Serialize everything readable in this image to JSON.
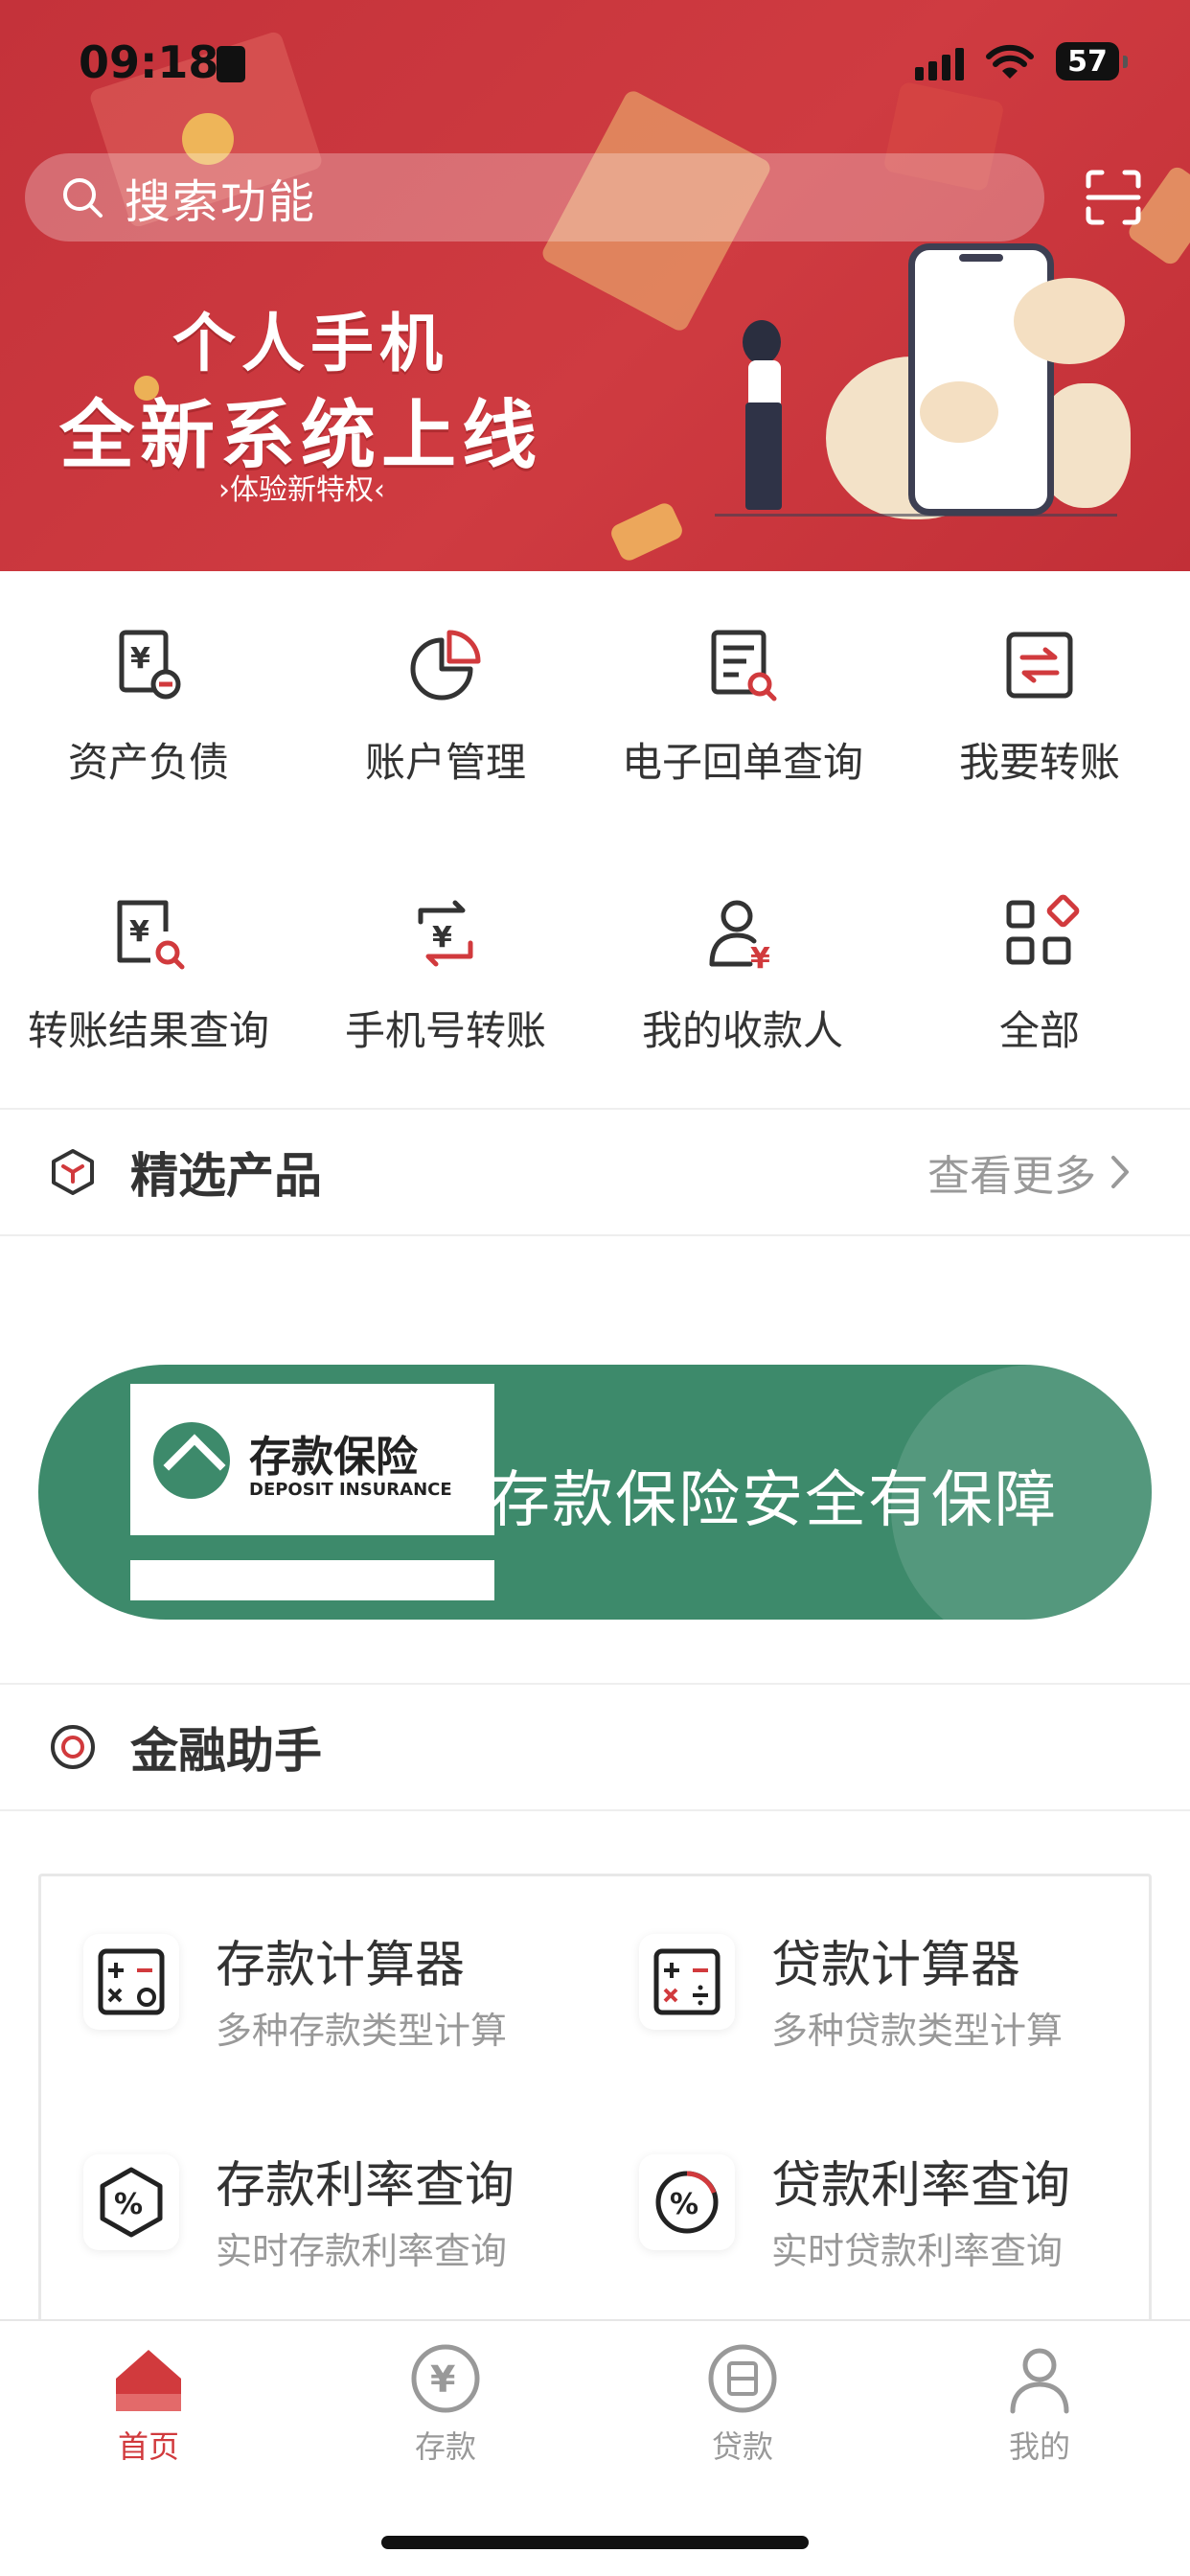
{
  "status_bar": {
    "time": "09:18",
    "battery": "57"
  },
  "search": {
    "placeholder": "搜索功能"
  },
  "banner": {
    "title_line1": "个人手机",
    "title_line2": "全新系统上线",
    "subtitle": "›体验新特权‹"
  },
  "quick_menu": [
    {
      "label": "资产负债",
      "icon": "asset-liability-icon"
    },
    {
      "label": "账户管理",
      "icon": "account-pie-icon"
    },
    {
      "label": "电子回单查询",
      "icon": "receipt-search-icon"
    },
    {
      "label": "我要转账",
      "icon": "transfer-icon"
    },
    {
      "label": "转账结果查询",
      "icon": "transfer-result-icon"
    },
    {
      "label": "手机号转账",
      "icon": "phone-transfer-icon"
    },
    {
      "label": "我的收款人",
      "icon": "payee-icon"
    },
    {
      "label": "全部",
      "icon": "all-apps-icon"
    }
  ],
  "featured": {
    "title": "精选产品",
    "more": "查看更多"
  },
  "promo": {
    "brand": "存款保险",
    "brand_en": "DEPOSIT INSURANCE",
    "slogan": "存款保险安全有保障"
  },
  "assistant": {
    "title": "金融助手",
    "tools": [
      {
        "name": "存款计算器",
        "desc": "多种存款类型计算",
        "icon": "deposit-calculator-icon"
      },
      {
        "name": "贷款计算器",
        "desc": "多种贷款类型计算",
        "icon": "loan-calculator-icon"
      },
      {
        "name": "存款利率查询",
        "desc": "实时存款利率查询",
        "icon": "deposit-rate-icon"
      },
      {
        "name": "贷款利率查询",
        "desc": "实时贷款利率查询",
        "icon": "loan-rate-icon"
      }
    ]
  },
  "tabbar": [
    {
      "label": "首页",
      "icon": "home-icon",
      "active": true
    },
    {
      "label": "存款",
      "icon": "deposit-icon",
      "active": false
    },
    {
      "label": "贷款",
      "icon": "loan-icon",
      "active": false
    },
    {
      "label": "我的",
      "icon": "profile-icon",
      "active": false
    }
  ],
  "colors": {
    "brand_red": "#c9353b",
    "promo_green": "#3d8a6b",
    "accent_red": "#d13a3d"
  }
}
